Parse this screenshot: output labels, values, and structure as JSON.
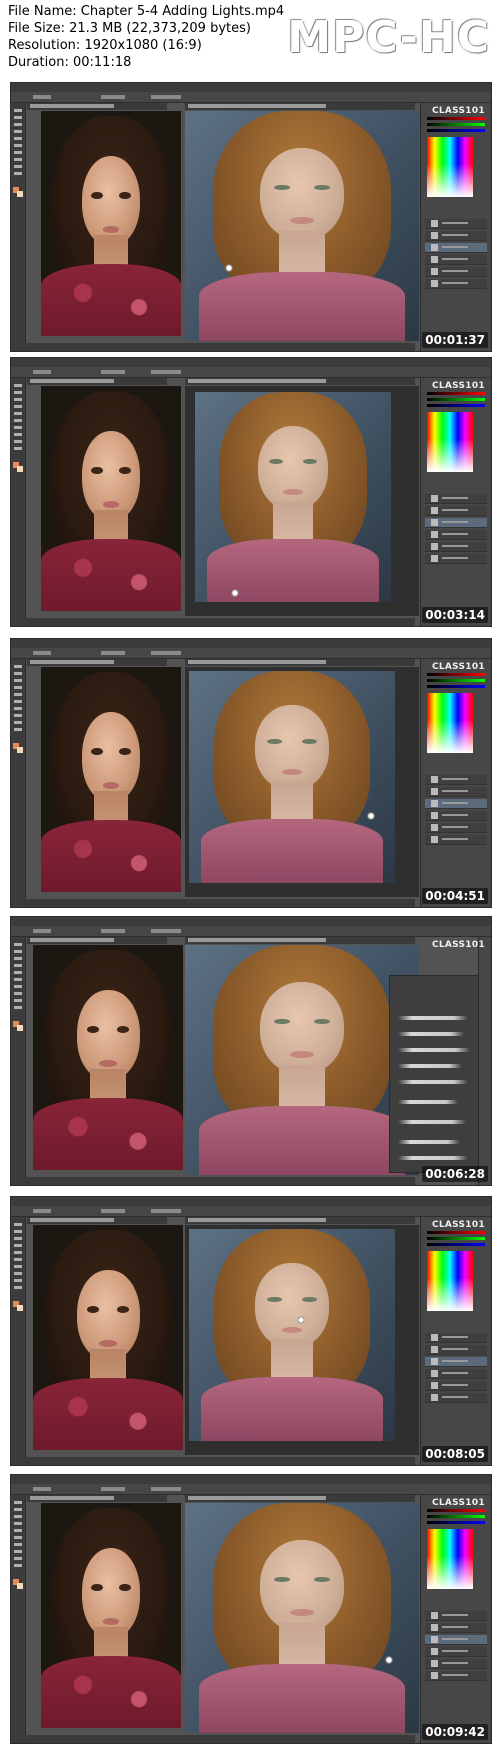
{
  "header": {
    "file_name": "File Name: Chapter 5-4 Adding Lights.mp4",
    "file_size": "File Size: 21.3 MB (22,373,209 bytes)",
    "resolution": "Resolution: 1920x1080 (16:9)",
    "duration": "Duration: 00:11:18",
    "player_logo": "MPC-HC"
  },
  "overlay": {
    "watermark": "CLASS101"
  },
  "thumbnails": [
    {
      "timestamp": "00:01:37"
    },
    {
      "timestamp": "00:03:14"
    },
    {
      "timestamp": "00:04:51"
    },
    {
      "timestamp": "00:06:28"
    },
    {
      "timestamp": "00:08:05"
    },
    {
      "timestamp": "00:09:42"
    }
  ],
  "colors": {
    "ui_dark": "#3c3c3c",
    "ui_mid": "#535353",
    "foreground_swatch": "#e88a5c",
    "background_swatch": "#f3d8b8"
  }
}
